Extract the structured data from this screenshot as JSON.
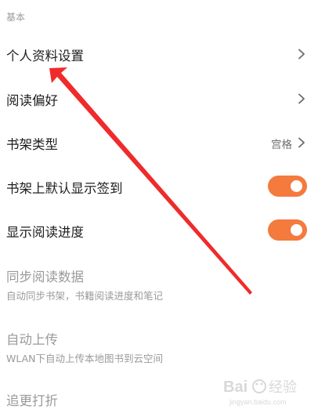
{
  "section": {
    "title": "基本"
  },
  "rows": [
    {
      "label": "个人资料设置",
      "type": "nav"
    },
    {
      "label": "阅读偏好",
      "type": "nav"
    },
    {
      "label": "书架类型",
      "type": "nav",
      "value": "宫格"
    },
    {
      "label": "书架上默认显示签到",
      "type": "toggle",
      "on": true
    },
    {
      "label": "显示阅读进度",
      "type": "toggle",
      "on": true
    },
    {
      "label": "同步阅读数据",
      "type": "disabled",
      "sub": "自动同步书架，书籍阅读进度和笔记"
    },
    {
      "label": "自动上传",
      "type": "disabled",
      "sub": "WLAN下自动上传本地图书到云空间"
    },
    {
      "label": "追更打折",
      "type": "disabled"
    }
  ],
  "colors": {
    "toggle_on": "#f47a3d",
    "annotation": "#ef2b2b"
  },
  "icons": {
    "chevron": "chevron-right-icon"
  },
  "watermark": {
    "text": "Bai 经验",
    "subtext": "jingyan.baidu.com"
  }
}
